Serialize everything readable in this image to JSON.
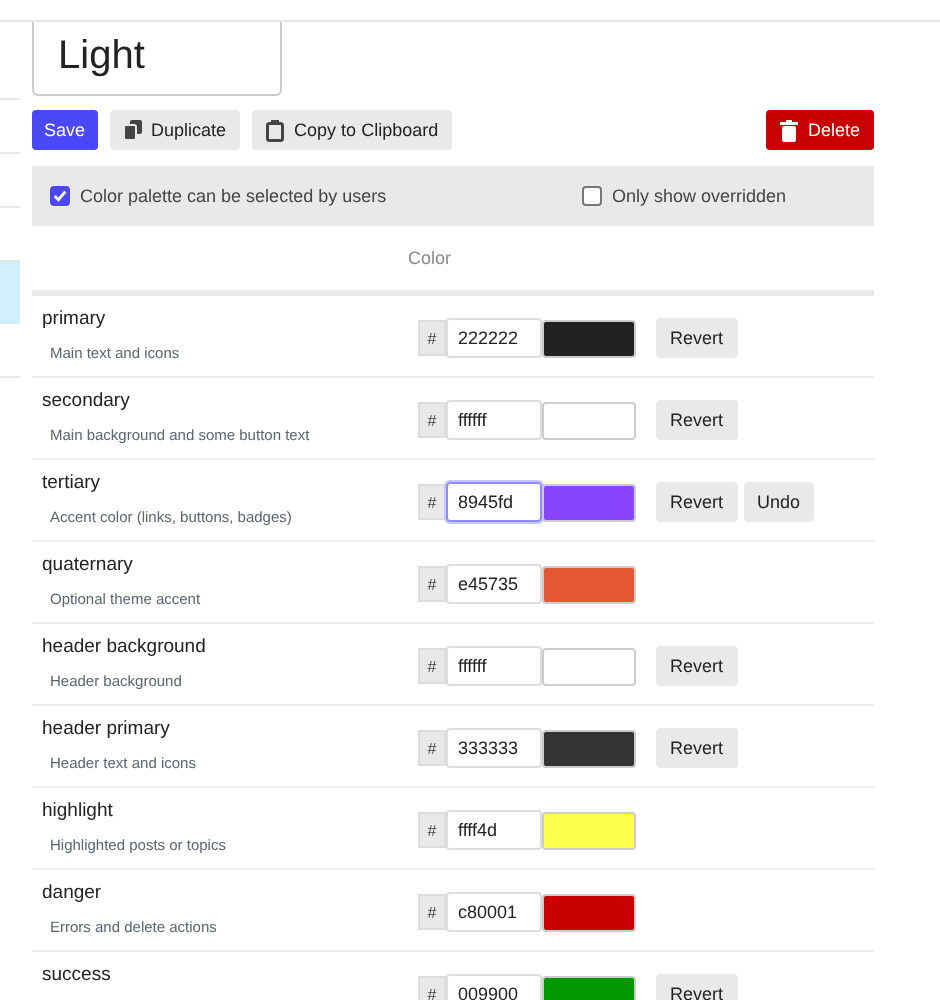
{
  "sidebar": {
    "items": [
      {
        "selected": false
      },
      {
        "selected": false
      },
      {
        "selected": false
      },
      {
        "selected": false
      },
      {
        "selected": true
      },
      {
        "selected": false
      }
    ]
  },
  "name_field": {
    "value": "Light"
  },
  "buttons": [
    {
      "kind": "primary",
      "label": "Save"
    },
    {
      "kind": "duplicate",
      "label": "Duplicate"
    },
    {
      "kind": "clipboard",
      "label": "Copy to Clipboard"
    },
    {
      "kind": "danger",
      "label": "Delete"
    }
  ],
  "options": [
    {
      "label": "Color palette can be selected by users",
      "checked": true
    },
    {
      "label": "Only show overridden",
      "checked": false
    }
  ],
  "table": {
    "column_header": "Color",
    "rows": [
      {
        "name": "primary",
        "description": "Main text and icons",
        "hash": "#",
        "value": "222222",
        "color": "#222222",
        "revert": "Revert",
        "focused": false
      },
      {
        "name": "secondary",
        "description": "Main background and some button text",
        "hash": "#",
        "value": "ffffff",
        "color": "#ffffff",
        "revert": "Revert",
        "focused": false
      },
      {
        "name": "tertiary",
        "description": "Accent color (links, buttons, badges)",
        "hash": "#",
        "value": "8945fd",
        "color": "#8945fd",
        "revert": "Revert",
        "undo": "Undo",
        "focused": true
      },
      {
        "name": "quaternary",
        "description": "Optional theme accent",
        "hash": "#",
        "value": "e45735",
        "color": "#e45735",
        "focused": false
      },
      {
        "name": "header background",
        "description": "Header background",
        "hash": "#",
        "value": "ffffff",
        "color": "#ffffff",
        "revert": "Revert",
        "focused": false
      },
      {
        "name": "header primary",
        "description": "Header text and icons",
        "hash": "#",
        "value": "333333",
        "color": "#333333",
        "revert": "Revert",
        "focused": false
      },
      {
        "name": "highlight",
        "description": "Highlighted posts or topics",
        "hash": "#",
        "value": "ffff4d",
        "color": "#ffff4d",
        "focused": false
      },
      {
        "name": "danger",
        "description": "Errors and delete actions",
        "hash": "#",
        "value": "c80001",
        "color": "#c80001",
        "focused": false
      },
      {
        "name": "success",
        "hash": "#",
        "value": "009900",
        "color": "#009900",
        "revert": "Revert",
        "focused": false
      }
    ]
  }
}
